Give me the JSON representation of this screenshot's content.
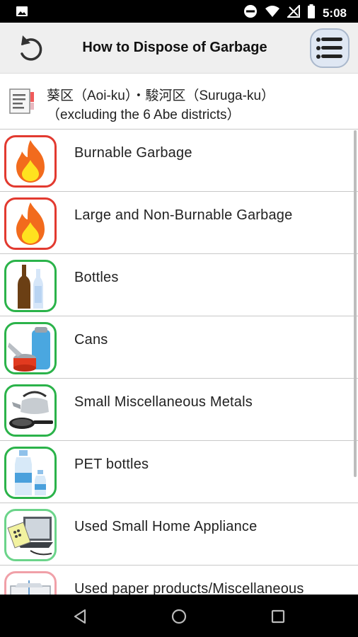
{
  "status_bar": {
    "time": "5:08",
    "icons": [
      "image-icon",
      "do-not-disturb-icon",
      "wifi-icon",
      "no-signal-icon",
      "battery-icon"
    ]
  },
  "app_bar": {
    "title": "How to Dispose of Garbage",
    "back_icon": "undo-icon",
    "menu_icon": "hamburger-menu-icon"
  },
  "district": {
    "line1": "葵区（Aoi-ku）・駿河区（Suruga-ku）",
    "line2": "（excluding the 6 Abe districts）",
    "icon": "document-icon"
  },
  "categories": [
    {
      "label": "Burnable Garbage",
      "icon": "fire-icon",
      "border": "#e23a30"
    },
    {
      "label": "Large and Non-Burnable Garbage",
      "icon": "fire-icon",
      "border": "#e23a30"
    },
    {
      "label": "Bottles",
      "icon": "bottles-icon",
      "border": "#2bb34a"
    },
    {
      "label": "Cans",
      "icon": "cans-icon",
      "border": "#2bb34a"
    },
    {
      "label": "Small Miscellaneous Metals",
      "icon": "kettle-pan-icon",
      "border": "#2bb34a"
    },
    {
      "label": "PET bottles",
      "icon": "pet-bottles-icon",
      "border": "#2bb34a"
    },
    {
      "label": "Used Small Home Appliance",
      "icon": "laptop-icon",
      "border": "#6bd48a"
    },
    {
      "label": "Used paper products/Miscellaneous",
      "icon": "paper-icon",
      "border": "#f0a0a8"
    }
  ],
  "nav_bar": {
    "icons": [
      "back-triangle-icon",
      "home-circle-icon",
      "recents-square-icon"
    ]
  }
}
